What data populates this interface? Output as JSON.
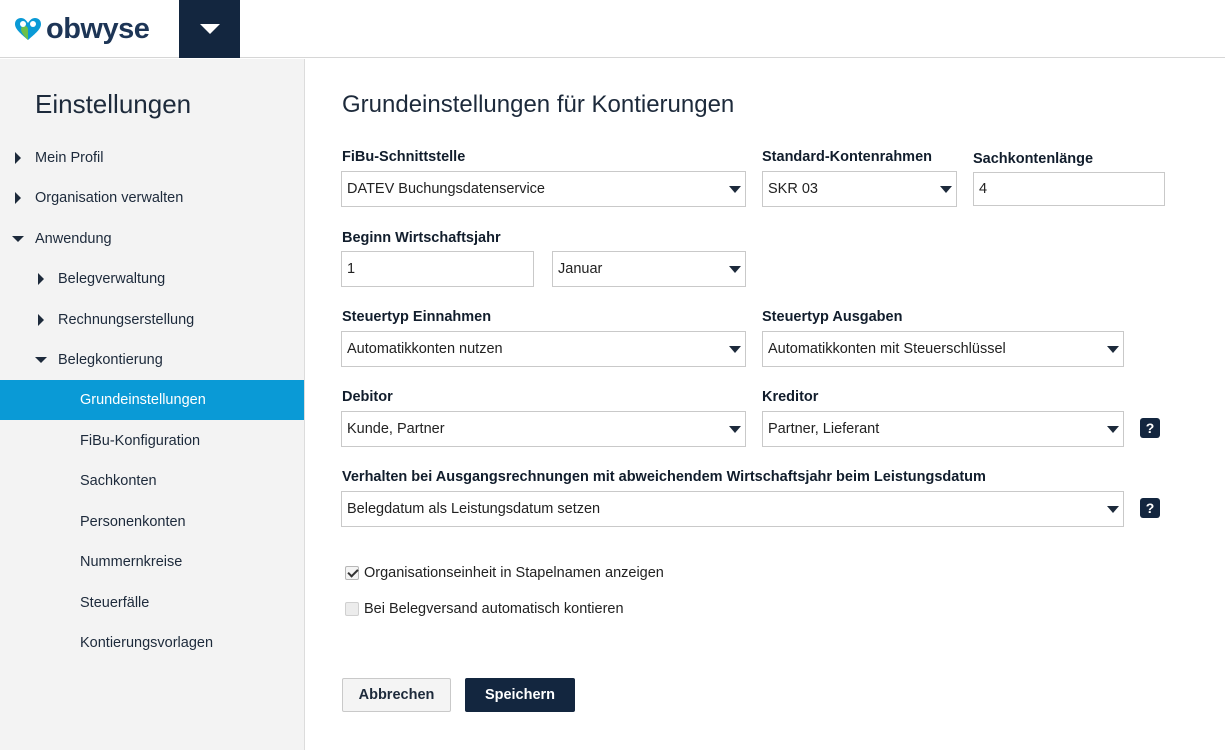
{
  "header": {
    "logo_text": "obwyse",
    "menu_icon": "caret-down-icon"
  },
  "sidebar": {
    "title": "Einstellungen",
    "items": [
      {
        "label": "Mein Profil",
        "arrow": "right"
      },
      {
        "label": "Organisation verwalten",
        "arrow": "right"
      },
      {
        "label": "Anwendung",
        "arrow": "down"
      },
      {
        "label": "Belegverwaltung",
        "arrow": "right"
      },
      {
        "label": "Rechnungserstellung",
        "arrow": "right"
      },
      {
        "label": "Belegkontierung",
        "arrow": "down"
      },
      {
        "label": "Grundeinstellungen",
        "active": true
      },
      {
        "label": "FiBu-Konfiguration"
      },
      {
        "label": "Sachkonten"
      },
      {
        "label": "Personenkonten"
      },
      {
        "label": "Nummernkreise"
      },
      {
        "label": "Steuerfälle"
      },
      {
        "label": "Kontierungsvorlagen"
      }
    ]
  },
  "main": {
    "title": "Grundeinstellungen für Kontierungen",
    "fibu": {
      "label": "FiBu-Schnittstelle",
      "value": "DATEV Buchungsdatenservice"
    },
    "kontenrahmen": {
      "label": "Standard-Kontenrahmen",
      "value": "SKR 03"
    },
    "sachkontenlaenge": {
      "label": "Sachkontenlänge",
      "value": "4"
    },
    "wirtschaftsjahr": {
      "label": "Beginn Wirtschaftsjahr",
      "day": "1",
      "month": "Januar"
    },
    "steuer_einnahmen": {
      "label": "Steuertyp Einnahmen",
      "value": "Automatikkonten nutzen"
    },
    "steuer_ausgaben": {
      "label": "Steuertyp Ausgaben",
      "value": "Automatikkonten mit Steuerschlüssel"
    },
    "debitor": {
      "label": "Debitor",
      "value": "Kunde, Partner"
    },
    "kreditor": {
      "label": "Kreditor",
      "value": "Partner, Lieferant"
    },
    "verhalten": {
      "label": "Verhalten bei Ausgangsrechnungen mit abweichendem Wirtschaftsjahr beim Leistungsdatum",
      "value": "Belegdatum als Leistungsdatum setzen"
    },
    "help_glyph": "?",
    "checkboxes": [
      {
        "label": "Organisationseinheit in Stapelnamen anzeigen",
        "checked": true
      },
      {
        "label": "Bei Belegversand automatisch kontieren",
        "checked": false
      }
    ],
    "cancel_label": "Abbrechen",
    "save_label": "Speichern"
  },
  "colors": {
    "accent": "#0a9ad6",
    "navy": "#13263f"
  }
}
